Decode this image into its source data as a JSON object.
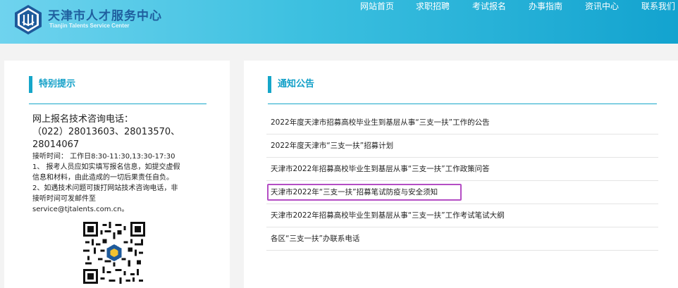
{
  "header": {
    "logo_cn": "天津市人才服务中心",
    "logo_en": "Tianjin Talents Service Center",
    "nav": [
      "网站首页",
      "求职招聘",
      "考试报名",
      "办事指南",
      "资讯中心",
      "联系我们"
    ],
    "colors": {
      "gradient_start": "#6fd3ee",
      "gradient_end": "#13a3cf",
      "logo_text": "#1f5f9f"
    }
  },
  "left_panel": {
    "title": "特别提示",
    "consult_label": "网上报名技术咨询电话：",
    "phones_line1": "（022）28013603、28013570、",
    "phones_line2": "28014067",
    "hours": "接听时间： 工作日8:30-11:30,13:30-17:30",
    "note1_line1": "1、 报考人员应如实填写报名信息，如提交虚假",
    "note1_line2": "信息和材料，由此造成的一切后果责任自负。",
    "note2_line1": "2、如遇技术问题可拨打网站技术咨询电话，非",
    "note2_line2": "接听时间可发邮件至",
    "email": "service@tjtalents.com.cn。",
    "qr_icon": "qr-code"
  },
  "right_panel": {
    "title": "通知公告",
    "notices": [
      "2022年度天津市招募高校毕业生到基层从事“三支一扶”工作的公告",
      "2022年度天津市“三支一扶”招募计划",
      "天津市2022年招募高校毕业生到基层从事“三支一扶”工作政策问答",
      "天津市2022年“三支一扶”招募笔试防疫与安全须知",
      "天津市2022年招募高校毕业生到基层从事“三支一扶”工作考试笔试大纲",
      "各区“三支一扶”办联系电话"
    ],
    "highlight_index": 3,
    "highlight_color": "#b44ec4"
  },
  "accent_color": "#16a6c9"
}
